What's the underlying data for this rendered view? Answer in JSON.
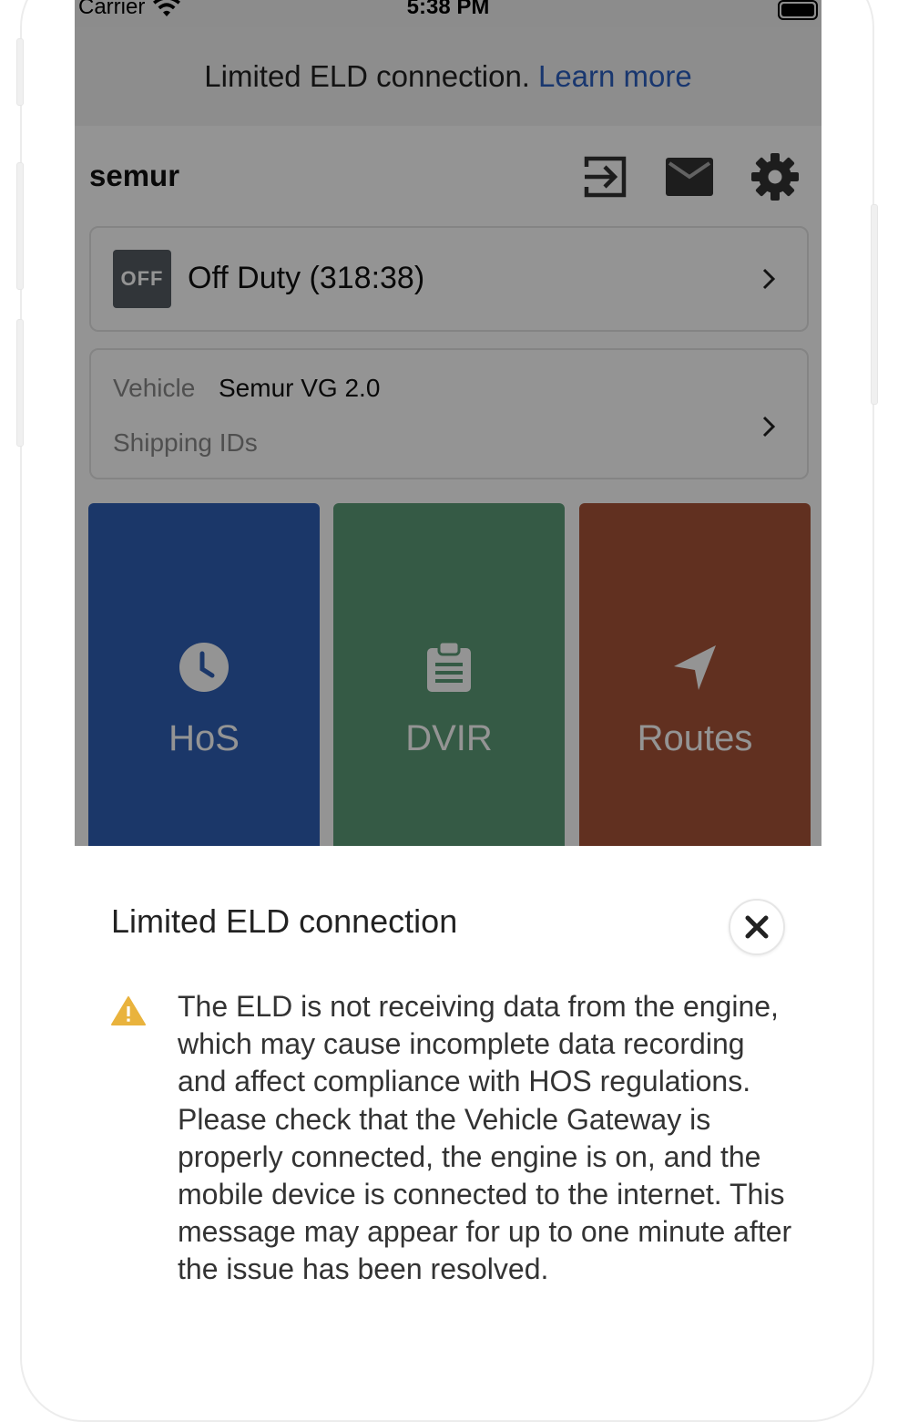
{
  "status_bar": {
    "carrier": "Carrier",
    "time": "5:38 PM"
  },
  "eld_banner": {
    "message": "Limited ELD connection.",
    "link": "Learn more"
  },
  "header": {
    "username": "semur",
    "icons": [
      "logout-icon",
      "mail-icon",
      "gear-icon"
    ]
  },
  "duty_status": {
    "badge": "OFF",
    "label": "Off Duty (318:38)"
  },
  "vehicle": {
    "label": "Vehicle",
    "value": "Semur VG 2.0",
    "shipping_label": "Shipping IDs"
  },
  "tiles": [
    {
      "label": "HoS",
      "icon": "clock-icon",
      "color": "#3060b5"
    },
    {
      "label": "DVIR",
      "icon": "clipboard-icon",
      "color": "#5c9c78"
    },
    {
      "label": "Routes",
      "icon": "navigation-arrow-icon",
      "color": "#a75438"
    }
  ],
  "sheet": {
    "title": "Limited ELD connection",
    "body": "The ELD is not receiving data from the engine, which may cause incomplete data recording and affect compliance with HOS regulations. Please check that the Vehicle Gateway is properly connected, the engine is on, and the mobile device is connected to the internet. This message may appear for up to one minute after the issue has been resolved.",
    "warning_color": "#e9b33d",
    "link_color": "#2c5fbf"
  }
}
